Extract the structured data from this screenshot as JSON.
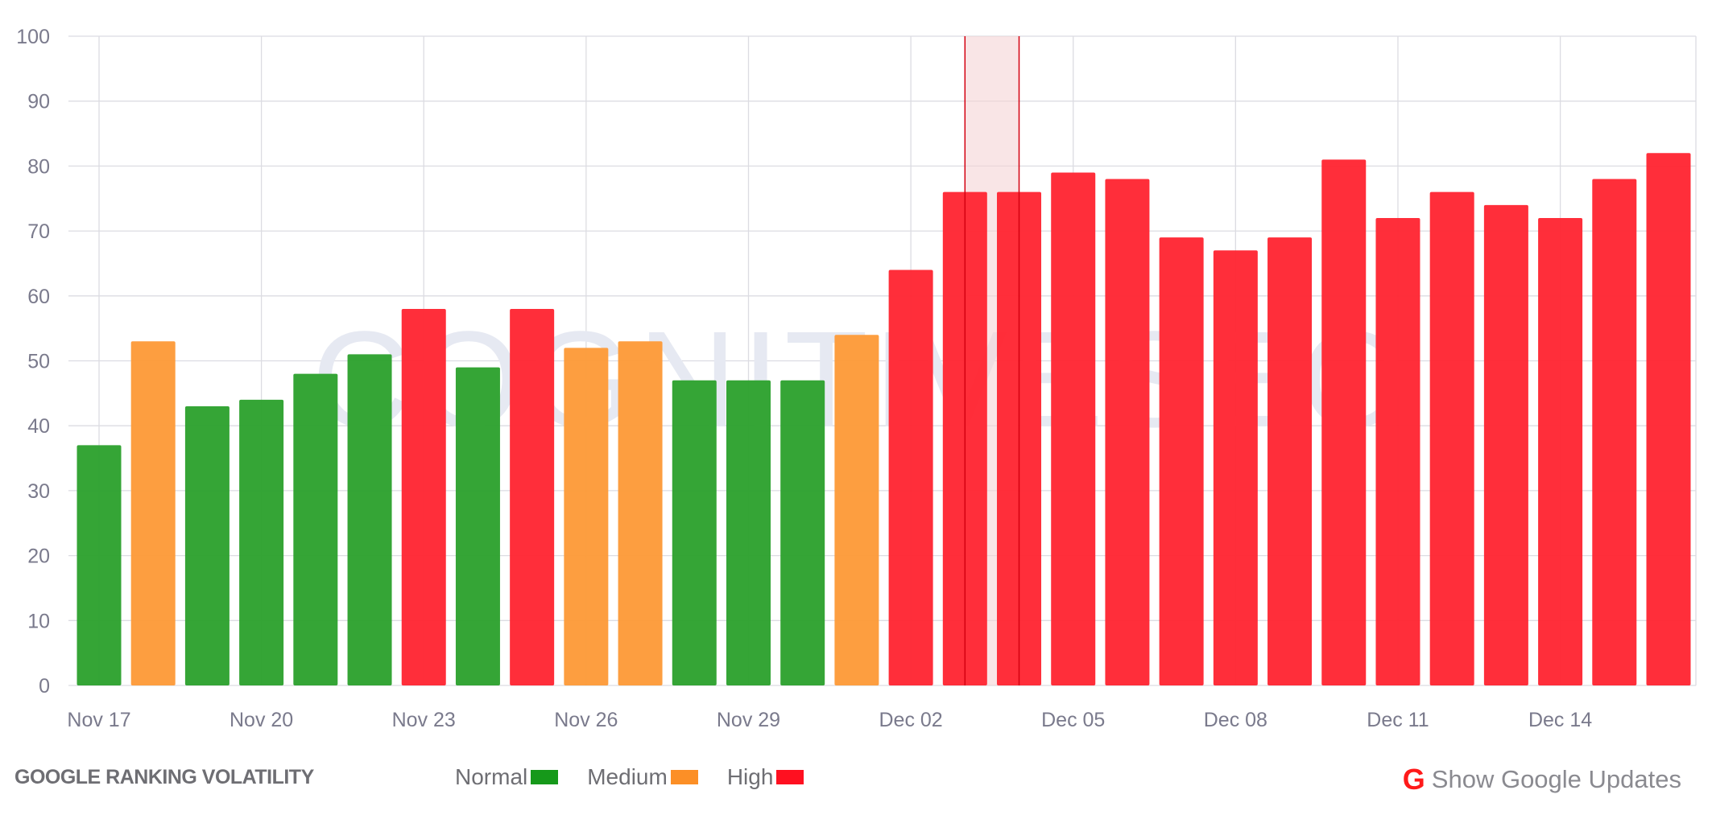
{
  "chart_data": {
    "type": "bar",
    "title": "GOOGLE RANKING VOLATILITY",
    "watermark": "COGNITIVESEO",
    "ylim": [
      0,
      100
    ],
    "yticks": [
      0,
      10,
      20,
      30,
      40,
      50,
      60,
      70,
      80,
      90,
      100
    ],
    "grid": true,
    "categories": [
      "Nov 17",
      "Nov 18",
      "Nov 19",
      "Nov 20",
      "Nov 21",
      "Nov 22",
      "Nov 23",
      "Nov 24",
      "Nov 25",
      "Nov 26",
      "Nov 27",
      "Nov 28",
      "Nov 29",
      "Nov 30",
      "Dec 01",
      "Dec 02",
      "Dec 03",
      "Dec 04",
      "Dec 05",
      "Dec 06",
      "Dec 07",
      "Dec 08",
      "Dec 09",
      "Dec 10",
      "Dec 11",
      "Dec 12",
      "Dec 13",
      "Dec 14",
      "Dec 15",
      "Dec 16"
    ],
    "xtick_labels": [
      "Nov 17",
      "Nov 20",
      "Nov 23",
      "Nov 26",
      "Nov 29",
      "Dec 02",
      "Dec 05",
      "Dec 08",
      "Dec 11",
      "Dec 14"
    ],
    "values": [
      37,
      53,
      43,
      44,
      48,
      51,
      58,
      49,
      58,
      52,
      53,
      47,
      47,
      47,
      54,
      64,
      76,
      76,
      79,
      78,
      69,
      67,
      69,
      81,
      72,
      76,
      74,
      72,
      78,
      82
    ],
    "levels": [
      "Normal",
      "Medium",
      "Normal",
      "Normal",
      "Normal",
      "Normal",
      "High",
      "Normal",
      "High",
      "Medium",
      "Medium",
      "Normal",
      "Normal",
      "Normal",
      "Medium",
      "High",
      "High",
      "High",
      "High",
      "High",
      "High",
      "High",
      "High",
      "High",
      "High",
      "High",
      "High",
      "High",
      "High",
      "High"
    ],
    "highlight_range": [
      "Dec 03",
      "Dec 04"
    ],
    "legend": [
      {
        "label": "Normal",
        "color": "#16991a"
      },
      {
        "label": "Medium",
        "color": "#fc8f26"
      },
      {
        "label": "High",
        "color": "#ff1020"
      }
    ],
    "bar_colors": {
      "Normal": "#2ea22f",
      "Medium": "#fd9b3a",
      "High": "#ff2734"
    },
    "legend_placement": "bottom"
  },
  "footer": {
    "google_icon": "G",
    "show_updates_label": "Show Google Updates"
  }
}
